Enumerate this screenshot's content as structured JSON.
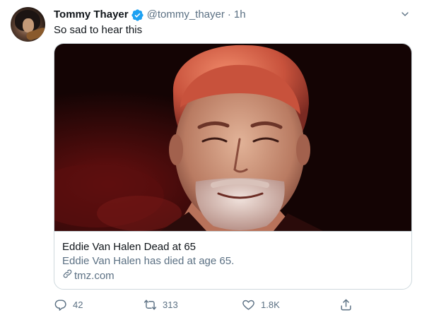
{
  "tweet": {
    "author_name": "Tommy Thayer",
    "author_handle": "@tommy_thayer",
    "separator": "·",
    "time": "1h",
    "text": "So sad to hear this",
    "verified": true
  },
  "card": {
    "title": "Eddie Van Halen Dead at 65",
    "description": "Eddie Van Halen has died at age 65.",
    "domain": "tmz.com",
    "image_alt": "Portrait of a smiling man with grey hair and stubble under red stage lighting"
  },
  "actions": {
    "reply_count": "42",
    "retweet_count": "313",
    "like_count": "1.8K"
  },
  "icons": {
    "verified": "verified-badge-icon",
    "caret": "chevron-down-icon",
    "link": "link-icon",
    "reply": "reply-icon",
    "retweet": "retweet-icon",
    "like": "heart-icon",
    "share": "share-icon"
  },
  "colors": {
    "verified_blue": "#1da1f2",
    "secondary_text": "#5b7083",
    "border": "#cfd9de"
  }
}
